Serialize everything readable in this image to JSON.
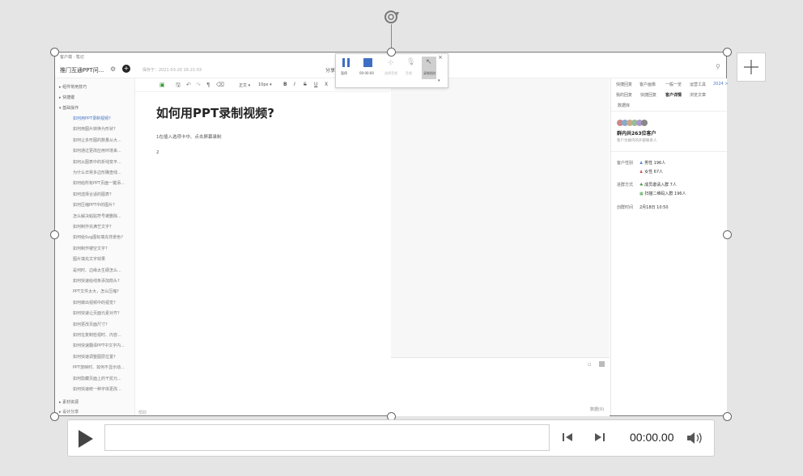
{
  "app": {
    "titlebar_text": "客户端 · 笔记",
    "doc_name": "推门互通PPT问...",
    "save_status": "保存于：2021-03-20 16:21:03",
    "share_label": "分享"
  },
  "left_tree": {
    "sections": [
      "组件常用技巧",
      "快捷键",
      "基础操作"
    ],
    "items": [
      "如何用PPT录制视频?",
      "如何用图片转换为形状?",
      "如何让多形图的数量从大...",
      "如何通过更改应用环境来...",
      "如何从图表中的折线变平...",
      "为什么日常多边形确查线...",
      "如何给所有PPT页面一键添...",
      "如何选择合适的图表?",
      "如何压缩PPT中的图片?",
      "怎么解决粘贴符号被删除...",
      "如何制作充满艺文字?",
      "如何给Svg图标填充背景色?",
      "如何制作镂空文字?",
      "图片填充文字效果",
      "是何时、边缘太生硬怎么...",
      "如何快速给线条添加箭头?",
      "PPT文件太大，怎么压缩?",
      "如何做出视频中的视觉?",
      "如何快速让页面元素对齐?",
      "如何更改页面尺寸?",
      "如何在复制检视时、内容...",
      "如何快速翻译PPT中文字内...",
      "如何快速调整图层位置?",
      "PPT放映时、如何不显示动...",
      "如何隐藏页面上的干扰元...",
      "如何快速统一种字体更改..."
    ],
    "bottom_sections": [
      "素材资源",
      "设计分享"
    ],
    "footer": "帮助"
  },
  "editor": {
    "title": "如何用PPT录制视频?",
    "line1": "1在插入选项卡中、点击屏幕录制",
    "line2": "2",
    "font_name": "正文",
    "font_size": "10px"
  },
  "right_pane": {
    "tabs_row1": [
      "快捷回复",
      "客户画像",
      "一般一览",
      "运营工具",
      "2024 >"
    ],
    "tabs_row2": [
      "我的回复",
      "快捷回复",
      "客户详情",
      "浏览文章"
    ],
    "tabs_row3": [
      "数据库"
    ],
    "group_title": "群内共263位客户",
    "group_sub": "客户为群内的外部联系人",
    "gender_label": "客户性别",
    "male": "男性 196人",
    "female": "女性 67人",
    "join_label": "进群方式",
    "join1": "成员邀请入群 7人",
    "join2": "扫描二维码入群 196人",
    "time_label": "创群时间",
    "time_value": "2月18日 10:50"
  },
  "lower_area": {
    "footer_text": "数据(0)"
  },
  "recorder": {
    "pause": "暂停",
    "stop": "00:00:00",
    "audio": "选择音频",
    "mic": "音频",
    "pointer": "录制指针"
  },
  "media": {
    "time": "00:00.00"
  }
}
